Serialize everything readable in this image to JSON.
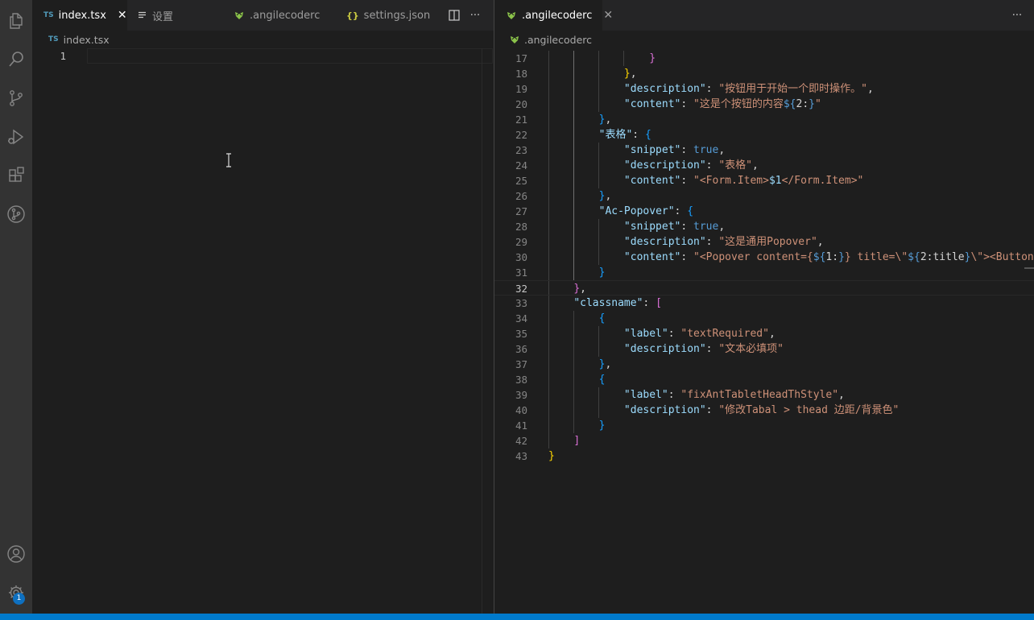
{
  "left": {
    "tabs": [
      {
        "label": "index.tsx",
        "type": "ts",
        "active": true
      },
      {
        "label": "设置",
        "type": "settings"
      },
      {
        "label": ".angilecoderc",
        "type": "angular"
      },
      {
        "label": "settings.json",
        "type": "json"
      }
    ],
    "ts_badge": "TS",
    "json_badge": "{}",
    "close_glyph": "✕",
    "more_glyph": "···",
    "breadcrumb": "index.tsx",
    "line_number": "1"
  },
  "right": {
    "tab_label": ".angilecoderc",
    "close_glyph": "✕",
    "more_glyph": "···",
    "breadcrumb": ".angilecoderc",
    "current_line": "32",
    "lines": [
      {
        "n": "17",
        "indent": 0,
        "tokens": [
          [
            "b1",
            "                "
          ],
          [
            "b2",
            "}"
          ]
        ]
      },
      {
        "n": "18",
        "tokens": [
          [
            "p",
            "            "
          ],
          [
            "b1",
            "}"
          ],
          [
            "p",
            ","
          ]
        ]
      },
      {
        "n": "19",
        "tokens": [
          [
            "p",
            "            "
          ],
          [
            "k",
            "\"description\""
          ],
          [
            "p",
            ": "
          ],
          [
            "s",
            "\"按钮用于开始一个即时操作。\""
          ],
          [
            "p",
            ","
          ]
        ]
      },
      {
        "n": "20",
        "tokens": [
          [
            "p",
            "            "
          ],
          [
            "k",
            "\"content\""
          ],
          [
            "p",
            ": "
          ],
          [
            "s",
            "\"这是个按钮的内容"
          ],
          [
            "kw",
            "${"
          ],
          [
            "p",
            "2:"
          ],
          [
            "kw",
            "}"
          ],
          [
            "s",
            "\""
          ]
        ]
      },
      {
        "n": "21",
        "tokens": [
          [
            "p",
            "        "
          ],
          [
            "b3",
            "}"
          ],
          [
            "p",
            ","
          ]
        ]
      },
      {
        "n": "22",
        "tokens": [
          [
            "p",
            "        "
          ],
          [
            "k",
            "\"表格\""
          ],
          [
            "p",
            ": "
          ],
          [
            "b3",
            "{"
          ]
        ]
      },
      {
        "n": "23",
        "tokens": [
          [
            "p",
            "            "
          ],
          [
            "k",
            "\"snippet\""
          ],
          [
            "p",
            ": "
          ],
          [
            "kw",
            "true"
          ],
          [
            "p",
            ","
          ]
        ]
      },
      {
        "n": "24",
        "tokens": [
          [
            "p",
            "            "
          ],
          [
            "k",
            "\"description\""
          ],
          [
            "p",
            ": "
          ],
          [
            "s",
            "\"表格\""
          ],
          [
            "p",
            ","
          ]
        ]
      },
      {
        "n": "25",
        "tokens": [
          [
            "p",
            "            "
          ],
          [
            "k",
            "\"content\""
          ],
          [
            "p",
            ": "
          ],
          [
            "s",
            "\"<Form.Item>"
          ],
          [
            "k",
            "$1"
          ],
          [
            "s",
            "</Form.Item>\""
          ]
        ]
      },
      {
        "n": "26",
        "tokens": [
          [
            "p",
            "        "
          ],
          [
            "b3",
            "}"
          ],
          [
            "p",
            ","
          ]
        ]
      },
      {
        "n": "27",
        "tokens": [
          [
            "p",
            "        "
          ],
          [
            "k",
            "\"Ac-Popover\""
          ],
          [
            "p",
            ": "
          ],
          [
            "b3",
            "{"
          ]
        ]
      },
      {
        "n": "28",
        "tokens": [
          [
            "p",
            "            "
          ],
          [
            "k",
            "\"snippet\""
          ],
          [
            "p",
            ": "
          ],
          [
            "kw",
            "true"
          ],
          [
            "p",
            ","
          ]
        ]
      },
      {
        "n": "29",
        "tokens": [
          [
            "p",
            "            "
          ],
          [
            "k",
            "\"description\""
          ],
          [
            "p",
            ": "
          ],
          [
            "s",
            "\"这是通用Popover\""
          ],
          [
            "p",
            ","
          ]
        ]
      },
      {
        "n": "30",
        "tokens": [
          [
            "p",
            "            "
          ],
          [
            "k",
            "\"content\""
          ],
          [
            "p",
            ": "
          ],
          [
            "s",
            "\"<Popover content={"
          ],
          [
            "kw",
            "${"
          ],
          [
            "p",
            "1:"
          ],
          [
            "kw",
            "}"
          ],
          [
            "s",
            "} title=\\\""
          ],
          [
            "kw",
            "${"
          ],
          [
            "p",
            "2:title"
          ],
          [
            "kw",
            "}"
          ],
          [
            "s",
            "\\\"><Button t"
          ]
        ]
      },
      {
        "n": "31",
        "tokens": [
          [
            "p",
            "        "
          ],
          [
            "b3",
            "}"
          ]
        ]
      },
      {
        "n": "32",
        "tokens": [
          [
            "p",
            "    "
          ],
          [
            "b2",
            "}"
          ],
          [
            "p",
            ","
          ]
        ]
      },
      {
        "n": "33",
        "tokens": [
          [
            "p",
            "    "
          ],
          [
            "k",
            "\"classname\""
          ],
          [
            "p",
            ": "
          ],
          [
            "b2",
            "["
          ]
        ]
      },
      {
        "n": "34",
        "tokens": [
          [
            "p",
            "        "
          ],
          [
            "b3",
            "{"
          ]
        ]
      },
      {
        "n": "35",
        "tokens": [
          [
            "p",
            "            "
          ],
          [
            "k",
            "\"label\""
          ],
          [
            "p",
            ": "
          ],
          [
            "s",
            "\"textRequired\""
          ],
          [
            "p",
            ","
          ]
        ]
      },
      {
        "n": "36",
        "tokens": [
          [
            "p",
            "            "
          ],
          [
            "k",
            "\"description\""
          ],
          [
            "p",
            ": "
          ],
          [
            "s",
            "\"文本必填项\""
          ]
        ]
      },
      {
        "n": "37",
        "tokens": [
          [
            "p",
            "        "
          ],
          [
            "b3",
            "}"
          ],
          [
            "p",
            ","
          ]
        ]
      },
      {
        "n": "38",
        "tokens": [
          [
            "p",
            "        "
          ],
          [
            "b3",
            "{"
          ]
        ]
      },
      {
        "n": "39",
        "tokens": [
          [
            "p",
            "            "
          ],
          [
            "k",
            "\"label\""
          ],
          [
            "p",
            ": "
          ],
          [
            "s",
            "\"fixAntTabletHeadThStyle\""
          ],
          [
            "p",
            ","
          ]
        ]
      },
      {
        "n": "40",
        "tokens": [
          [
            "p",
            "            "
          ],
          [
            "k",
            "\"description\""
          ],
          [
            "p",
            ": "
          ],
          [
            "s",
            "\"修改Tabal > thead 边距/背景色\""
          ]
        ]
      },
      {
        "n": "41",
        "tokens": [
          [
            "p",
            "        "
          ],
          [
            "b3",
            "}"
          ]
        ]
      },
      {
        "n": "42",
        "tokens": [
          [
            "p",
            "    "
          ],
          [
            "b2",
            "]"
          ]
        ]
      },
      {
        "n": "43",
        "tokens": [
          [
            "b1",
            "}"
          ]
        ]
      }
    ]
  },
  "activity": {
    "items": [
      "explorer-icon",
      "search-icon",
      "source-control-icon",
      "run-debug-icon",
      "extensions-icon",
      "git-graph-icon"
    ],
    "bottom": [
      "account-icon",
      "settings-gear-icon"
    ],
    "settings_badge": "1"
  },
  "colors": {
    "accent": "#007acc",
    "activity_bg": "#333333",
    "editor_bg": "#1e1e1e",
    "tabbar_bg": "#252526",
    "string": "#ce9178",
    "key": "#9cdcfe",
    "keyword": "#569cd6"
  }
}
